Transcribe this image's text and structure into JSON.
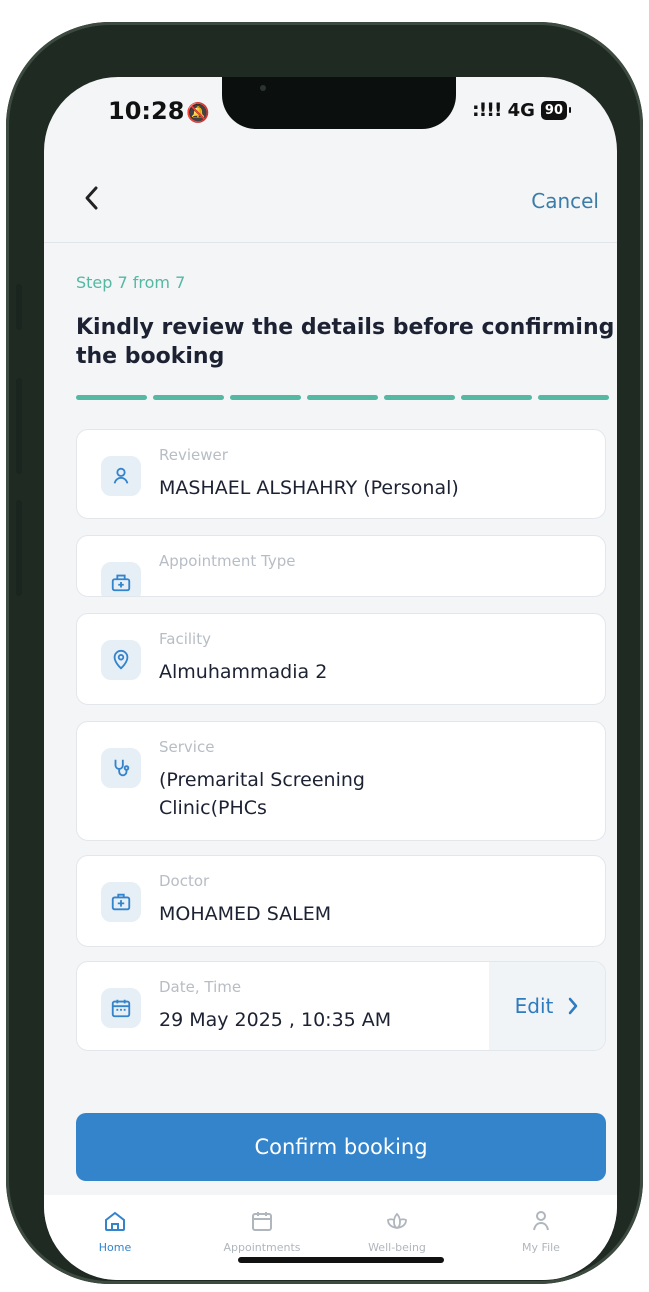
{
  "status_bar": {
    "time": "10:28",
    "network": "4G",
    "battery": "90"
  },
  "nav": {
    "cancel_label": "Cancel"
  },
  "step_label": "Step 7 from 7",
  "title": "Kindly review the details before confirming the booking",
  "progress": {
    "current_step": 7,
    "total_steps": 7
  },
  "cards": {
    "reviewer": {
      "label": "Reviewer",
      "value": "MASHAEL ALSHAHRY (Personal)"
    },
    "appointment_type": {
      "label": "Appointment Type",
      "value": ""
    },
    "facility": {
      "label": "Facility",
      "value": "Almuhammadia 2"
    },
    "service": {
      "label": "Service",
      "value": "(Premarital Screening Clinic(PHCs"
    },
    "doctor": {
      "label": "Doctor",
      "value": "MOHAMED SALEM"
    },
    "datetime": {
      "label": "Date, Time",
      "value": "29 May 2025 , 10:35 AM",
      "edit_label": "Edit"
    }
  },
  "confirm_label": "Confirm booking",
  "tabs": [
    {
      "label": "Home",
      "icon": "home-icon",
      "active": true
    },
    {
      "label": "Appointments",
      "icon": "calendar-icon",
      "active": false
    },
    {
      "label": "Well-being",
      "icon": "lotus-icon",
      "active": false
    },
    {
      "label": "My File",
      "icon": "person-icon",
      "active": false
    }
  ],
  "colors": {
    "accent": "#3484cc",
    "step": "#54b8a3",
    "link": "#3b7ca8"
  }
}
